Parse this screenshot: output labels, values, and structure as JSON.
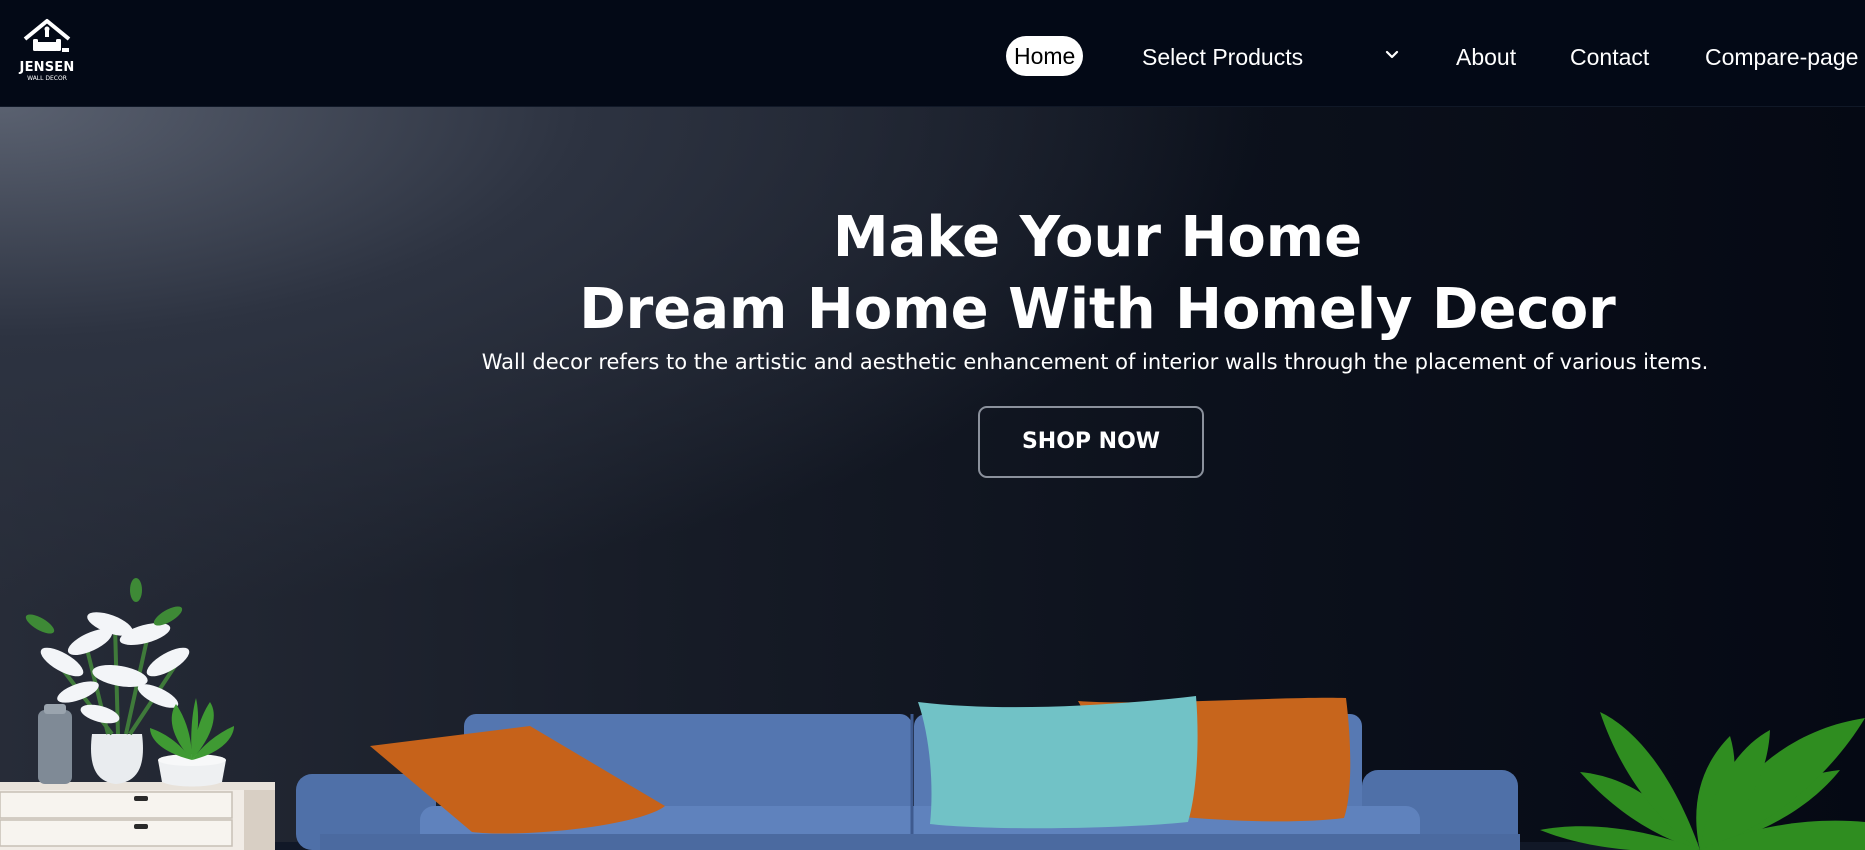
{
  "navbar": {
    "logo": {
      "name": "JENSEN",
      "subtitle": "WALL DECOR",
      "icon": "house-furniture-icon"
    },
    "links": {
      "home": "Home",
      "select_products": "Select Products",
      "about": "About",
      "contact": "Contact",
      "compare": "Compare-page"
    },
    "dropdown_icon": "chevron-down-icon",
    "active_link": "Home"
  },
  "hero": {
    "title_line1": "Make Your Home",
    "title_line2": "Dream Home With Homely Decor",
    "description": "Wall decor refers to the artistic and aesthetic enhancement of interior walls through the placement of various items.",
    "cta_label": "SHOP NOW"
  },
  "colors": {
    "navbar_bg": "#030916",
    "accent_active": "#ffffff",
    "sofa": "#5b7bb4",
    "pillow_orange": "#c8651a",
    "pillow_teal": "#6fc0c4",
    "plant_green": "#2e8a22"
  }
}
